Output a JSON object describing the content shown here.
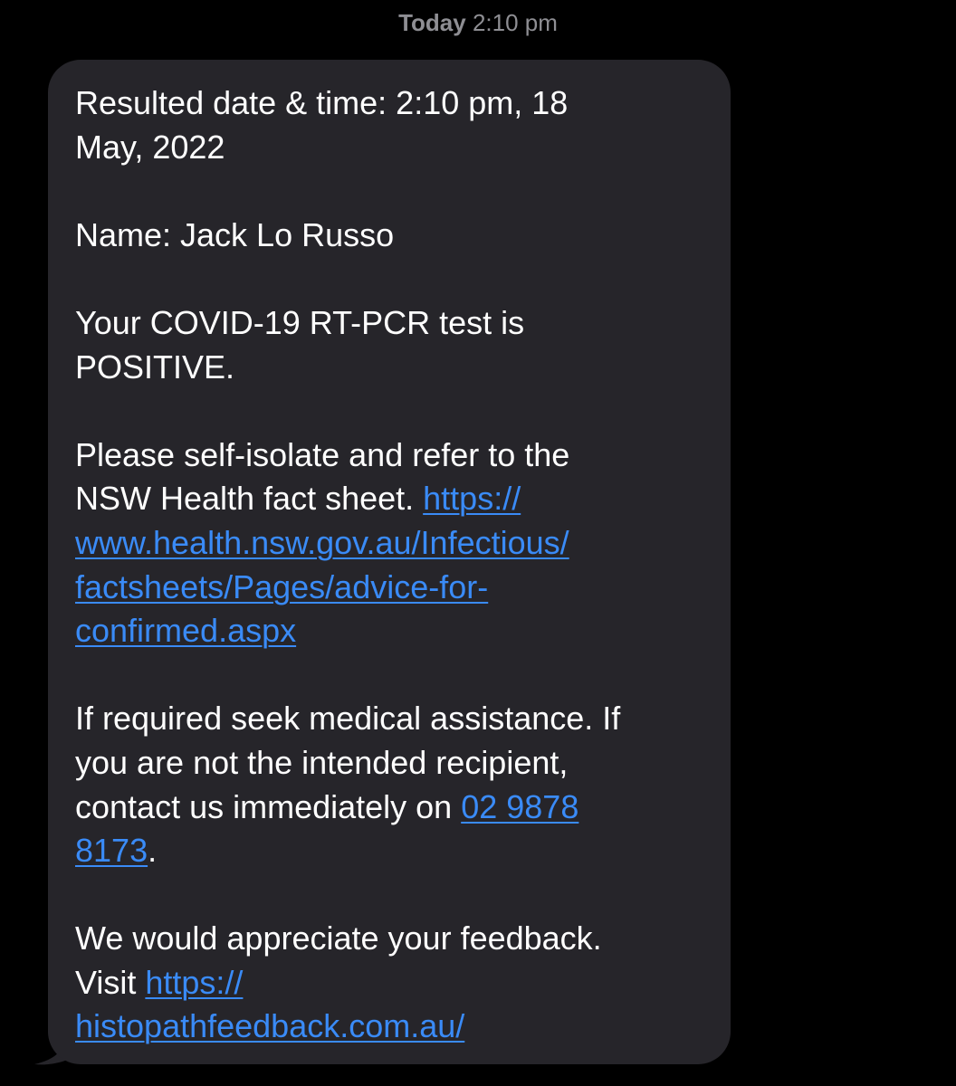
{
  "header": {
    "day": "Today",
    "time": "2:10 pm"
  },
  "message": {
    "result_line_1": "Resulted date & time: 2:10 pm, 18",
    "result_line_2": "May, 2022",
    "name_line": "Name: Jack Lo Russo",
    "test_line_1": "Your COVID-19 RT-PCR test is",
    "test_line_2": "POSITIVE.",
    "advice_line_1": "Please self-isolate and refer to the",
    "advice_line_2_text": "NSW Health fact sheet. ",
    "factsheet_link": {
      "part_1": "https://",
      "part_2": "www.health.nsw.gov.au/Infectious/",
      "part_3": "factsheets/Pages/advice-for-",
      "part_4": "confirmed.aspx"
    },
    "medical_line_1": "If required seek medical assistance. If",
    "medical_line_2": "you are not the intended recipient,",
    "medical_line_3_text": "contact us immediately on ",
    "phone_link": {
      "part_1": "02 9878",
      "part_2": "8173"
    },
    "phone_suffix": ".",
    "feedback_line_1": "We would appreciate your feedback.",
    "feedback_line_2_text": "Visit ",
    "feedback_link": {
      "part_1": "https://",
      "part_2": "histopathfeedback.com.au/"
    }
  },
  "colors": {
    "background": "#000000",
    "bubble": "#26252a",
    "text": "#ffffff",
    "link": "#3a8bf7",
    "timestamp": "#8e8e93"
  }
}
